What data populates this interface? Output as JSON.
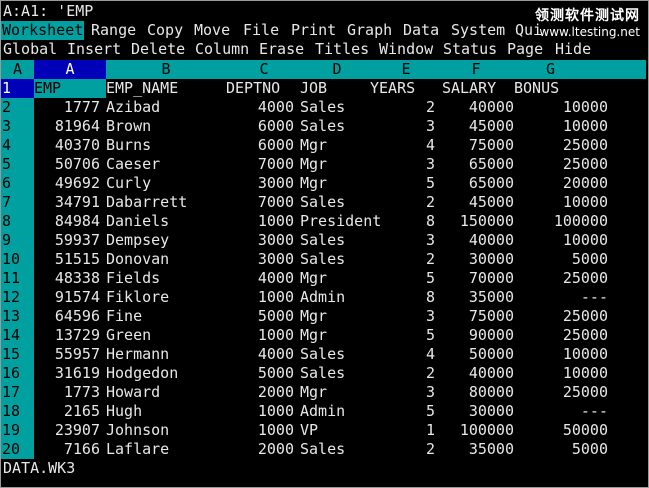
{
  "cell_address": "A:A1: 'EMP",
  "menu_main": [
    {
      "label": "Worksheet",
      "selected": true
    },
    {
      "label": "Range",
      "selected": false
    },
    {
      "label": "Copy",
      "selected": false
    },
    {
      "label": "Move",
      "selected": false
    },
    {
      "label": "File",
      "selected": false
    },
    {
      "label": "Print",
      "selected": false
    },
    {
      "label": "Graph",
      "selected": false
    },
    {
      "label": "Data",
      "selected": false
    },
    {
      "label": "System",
      "selected": false
    },
    {
      "label": "Qui",
      "selected": false
    }
  ],
  "menu_sub": [
    "Global",
    "Insert",
    "Delete",
    "Column",
    "Erase",
    "Titles",
    "Window",
    "Status",
    "Page",
    "Hide"
  ],
  "sheet_label": "A",
  "columns": [
    "A",
    "B",
    "C",
    "D",
    "E",
    "F",
    "G"
  ],
  "headers": [
    "EMP",
    "EMP_NAME",
    "DEPTNO",
    "JOB",
    "YEARS",
    "SALARY",
    "BONUS"
  ],
  "rows": [
    {
      "n": "2",
      "emp": "1777",
      "name": "Azibad",
      "dept": "4000",
      "job": "Sales",
      "years": "2",
      "salary": "40000",
      "bonus": "10000"
    },
    {
      "n": "3",
      "emp": "81964",
      "name": "Brown",
      "dept": "6000",
      "job": "Sales",
      "years": "3",
      "salary": "45000",
      "bonus": "10000"
    },
    {
      "n": "4",
      "emp": "40370",
      "name": "Burns",
      "dept": "6000",
      "job": "Mgr",
      "years": "4",
      "salary": "75000",
      "bonus": "25000"
    },
    {
      "n": "5",
      "emp": "50706",
      "name": "Caeser",
      "dept": "7000",
      "job": "Mgr",
      "years": "3",
      "salary": "65000",
      "bonus": "25000"
    },
    {
      "n": "6",
      "emp": "49692",
      "name": "Curly",
      "dept": "3000",
      "job": "Mgr",
      "years": "5",
      "salary": "65000",
      "bonus": "20000"
    },
    {
      "n": "7",
      "emp": "34791",
      "name": "Dabarrett",
      "dept": "7000",
      "job": "Sales",
      "years": "2",
      "salary": "45000",
      "bonus": "10000"
    },
    {
      "n": "8",
      "emp": "84984",
      "name": "Daniels",
      "dept": "1000",
      "job": "President",
      "years": "8",
      "salary": "150000",
      "bonus": "100000"
    },
    {
      "n": "9",
      "emp": "59937",
      "name": "Dempsey",
      "dept": "3000",
      "job": "Sales",
      "years": "3",
      "salary": "40000",
      "bonus": "10000"
    },
    {
      "n": "10",
      "emp": "51515",
      "name": "Donovan",
      "dept": "3000",
      "job": "Sales",
      "years": "2",
      "salary": "30000",
      "bonus": "5000"
    },
    {
      "n": "11",
      "emp": "48338",
      "name": "Fields",
      "dept": "4000",
      "job": "Mgr",
      "years": "5",
      "salary": "70000",
      "bonus": "25000"
    },
    {
      "n": "12",
      "emp": "91574",
      "name": "Fiklore",
      "dept": "1000",
      "job": "Admin",
      "years": "8",
      "salary": "35000",
      "bonus": "---"
    },
    {
      "n": "13",
      "emp": "64596",
      "name": "Fine",
      "dept": "5000",
      "job": "Mgr",
      "years": "3",
      "salary": "75000",
      "bonus": "25000"
    },
    {
      "n": "14",
      "emp": "13729",
      "name": "Green",
      "dept": "1000",
      "job": "Mgr",
      "years": "5",
      "salary": "90000",
      "bonus": "25000"
    },
    {
      "n": "15",
      "emp": "55957",
      "name": "Hermann",
      "dept": "4000",
      "job": "Sales",
      "years": "4",
      "salary": "50000",
      "bonus": "10000"
    },
    {
      "n": "16",
      "emp": "31619",
      "name": "Hodgedon",
      "dept": "5000",
      "job": "Sales",
      "years": "2",
      "salary": "40000",
      "bonus": "10000"
    },
    {
      "n": "17",
      "emp": "1773",
      "name": "Howard",
      "dept": "2000",
      "job": "Mgr",
      "years": "3",
      "salary": "80000",
      "bonus": "25000"
    },
    {
      "n": "18",
      "emp": "2165",
      "name": "Hugh",
      "dept": "1000",
      "job": "Admin",
      "years": "5",
      "salary": "30000",
      "bonus": "---"
    },
    {
      "n": "19",
      "emp": "23907",
      "name": "Johnson",
      "dept": "1000",
      "job": "VP",
      "years": "1",
      "salary": "100000",
      "bonus": "50000"
    },
    {
      "n": "20",
      "emp": "7166",
      "name": "Laflare",
      "dept": "2000",
      "job": "Sales",
      "years": "2",
      "salary": "35000",
      "bonus": "5000"
    }
  ],
  "header_row_number": "1",
  "status_file": "DATA.WK3",
  "watermark": {
    "title": "领测软件测试网",
    "url": "www.ltesting.net"
  }
}
